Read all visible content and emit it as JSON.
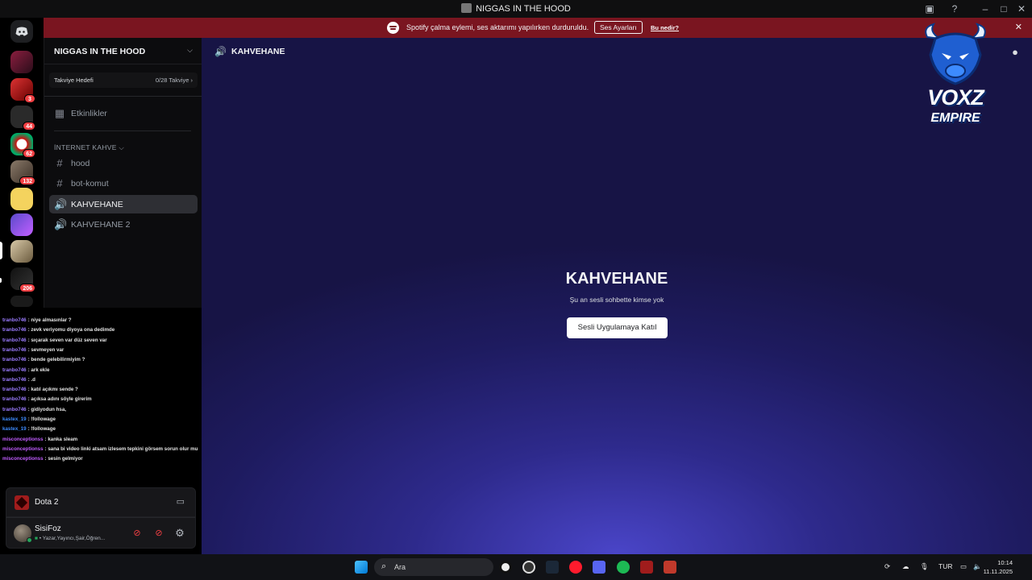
{
  "window": {
    "title": "NIGGAS IN THE HOOD"
  },
  "banner": {
    "message": "Spotify çalma eylemi, ses aktarımı yapılırken durduruldu.",
    "button": "Ses Ayarları",
    "link": "Bu nedir?"
  },
  "rail": {
    "badges": [
      "3",
      "44",
      "62",
      "132",
      "206"
    ]
  },
  "sidebar": {
    "server_name": "NIGGAS IN THE HOOD",
    "boost_goal": "Takviye Hedefi",
    "boost_count": "0/28 Takviye",
    "events": "Etkinlikler",
    "category": "İNTERNET KAHVE",
    "channels": [
      {
        "name": "hood",
        "type": "text"
      },
      {
        "name": "bot-komut",
        "type": "text"
      },
      {
        "name": "KAHVEHANE",
        "type": "voice"
      },
      {
        "name": "KAHVEHANE 2",
        "type": "voice"
      }
    ]
  },
  "chat": [
    {
      "user": "tranbo746",
      "text": ": niye almasınlar ?",
      "color": "#9b7bff"
    },
    {
      "user": "tranbo746",
      "text": ": zevk veriyomu diyoya ona dedimde",
      "color": "#9b7bff"
    },
    {
      "user": "tranbo746",
      "text": ": sıçarak seven var düz seven var",
      "color": "#9b7bff"
    },
    {
      "user": "tranbo746",
      "text": ": sevmeyen var",
      "color": "#9b7bff"
    },
    {
      "user": "tranbo746",
      "text": ": bende gelebilirmiyim ?",
      "color": "#9b7bff"
    },
    {
      "user": "tranbo746",
      "text": ": ark ekle",
      "color": "#9b7bff"
    },
    {
      "user": "tranbo746",
      "text": ": .d",
      "color": "#9b7bff"
    },
    {
      "user": "tranbo746",
      "text": ": katıl açıkmı sende ?",
      "color": "#9b7bff"
    },
    {
      "user": "tranbo746",
      "text": ": açıksa adını söyle girerim",
      "color": "#9b7bff"
    },
    {
      "user": "tranbo746",
      "text": ": gidiyodun hsa,",
      "color": "#9b7bff"
    },
    {
      "user": "kastex_19",
      "text": ": !followage",
      "color": "#3d8bff"
    },
    {
      "user": "kastex_19",
      "text": ": !followage",
      "color": "#3d8bff"
    },
    {
      "user": "misconceptionss",
      "text": ": kanka sleam",
      "color": "#c15cff"
    },
    {
      "user": "misconceptionss",
      "text": ": sana bi video linki atsam izlesem tepkini görsem sorun olur mu",
      "color": "#c15cff"
    },
    {
      "user": "misconceptionss",
      "text": ": sesin gelmiyor",
      "color": "#c15cff"
    }
  ],
  "activity": {
    "game": "Dota 2"
  },
  "user": {
    "name": "SisiFoz",
    "status": "• Yazar,Yayıncı,Şair,Öğren..."
  },
  "main": {
    "channel_title": "KAHVEHANE",
    "center_title": "KAHVEHANE",
    "center_subtitle": "Şu an sesli sohbette kimse yok",
    "join_button": "Sesli Uygulamaya Katıl"
  },
  "logo": {
    "line1": "VOXZ",
    "line2": "EMPIRE"
  },
  "taskbar": {
    "search_placeholder": "Ara",
    "language": "TUR",
    "time": "10:14",
    "date": "11.11.2025"
  },
  "colors": {
    "banner": "#7a1520",
    "main_bg": "#2e2a8c",
    "accent": "#5865f2"
  }
}
